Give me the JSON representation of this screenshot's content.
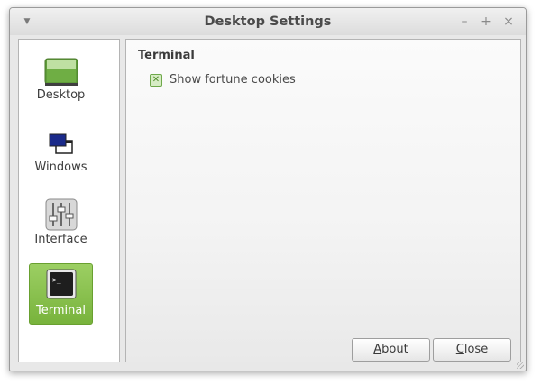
{
  "window": {
    "title": "Desktop Settings",
    "controls": {
      "minimize": "–",
      "maximize": "+",
      "close": "×",
      "menu": "▼"
    }
  },
  "sidebar": {
    "items": [
      {
        "label": "Desktop",
        "icon": "desktop-icon",
        "active": false
      },
      {
        "label": "Windows",
        "icon": "windows-icon",
        "active": false
      },
      {
        "label": "Interface",
        "icon": "interface-icon",
        "active": false
      },
      {
        "label": "Terminal",
        "icon": "terminal-icon",
        "active": true
      }
    ]
  },
  "main": {
    "section_title": "Terminal",
    "options": [
      {
        "label": "Show fortune cookies",
        "checked": true
      }
    ]
  },
  "buttons": {
    "about": {
      "mnemonic": "A",
      "rest": "bout"
    },
    "close": {
      "mnemonic": "C",
      "rest": "lose"
    }
  },
  "colors": {
    "accent": "#78b33c",
    "checkbox_border": "#6ea84a"
  }
}
